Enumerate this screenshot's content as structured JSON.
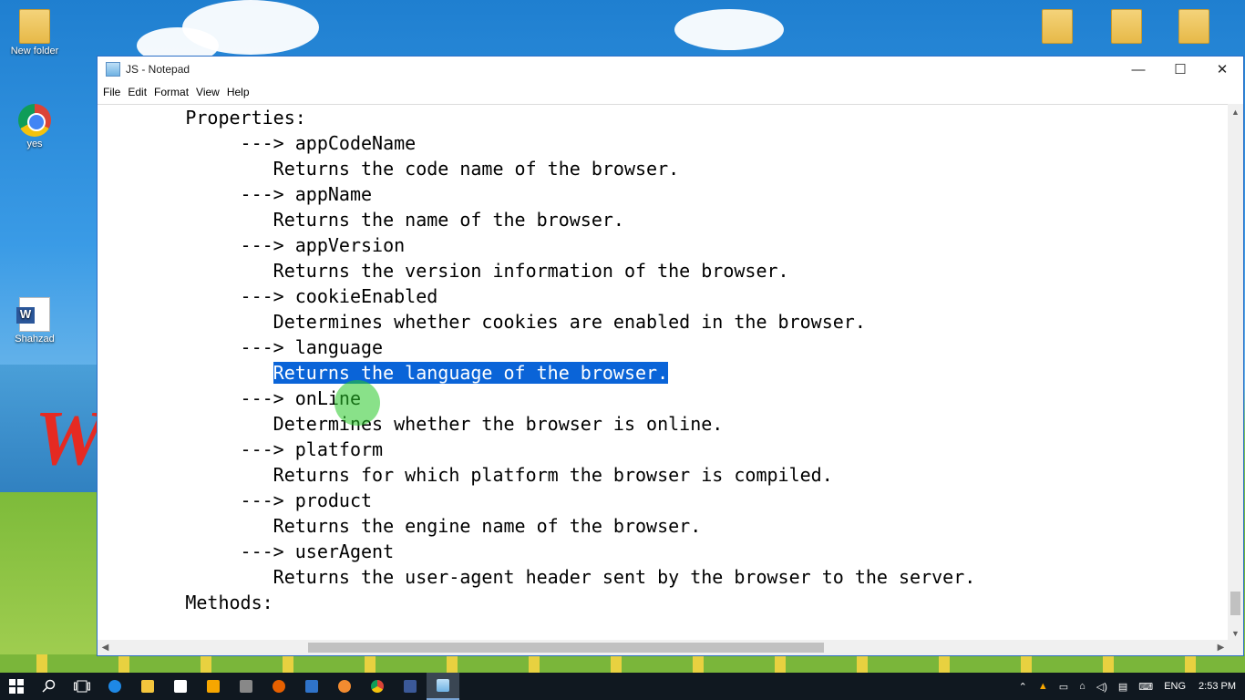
{
  "desktop": {
    "icons": [
      {
        "label": "New folder",
        "icon": "folder-icon"
      },
      {
        "label": "yes",
        "icon": "chrome-icon"
      },
      {
        "label": "Shahzad",
        "icon": "word-doc-icon"
      }
    ]
  },
  "window": {
    "title": "JS - Notepad",
    "controls": {
      "minimize": "—",
      "maximize": "☐",
      "close": "✕"
    },
    "menu": [
      "File",
      "Edit",
      "Format",
      "View",
      "Help"
    ],
    "menu_underline": [
      "F",
      "E",
      "o",
      "V",
      "H"
    ]
  },
  "editor": {
    "lines": [
      "        Properties:",
      "             ---> appCodeName",
      "                Returns the code name of the browser.",
      "             ---> appName",
      "                Returns the name of the browser.",
      "             ---> appVersion",
      "                Returns the version information of the browser.",
      "             ---> cookieEnabled",
      "                Determines whether cookies are enabled in the browser.",
      "             ---> language",
      "                ",
      "             ---> onLine",
      "                Determines whether the browser is online.",
      "             ---> platform",
      "                Returns for which platform the browser is compiled.",
      "             ---> product",
      "                Returns the engine name of the browser.",
      "             ---> userAgent",
      "                Returns the user-agent header sent by the browser to the server.",
      "        Methods:"
    ],
    "selected_text": "Returns the language of the browser."
  },
  "taskbar": {
    "apps": [
      "windows-start-icon",
      "search-icon",
      "task-view-icon",
      "edge-icon",
      "file-explorer-icon",
      "store-icon",
      "media-player-icon",
      "film-icon",
      "firefox-icon",
      "app-icon",
      "paint-icon",
      "chrome-icon",
      "facebook-icon",
      "notepad-icon"
    ],
    "language": "ENG",
    "time": "2:53 PM"
  }
}
